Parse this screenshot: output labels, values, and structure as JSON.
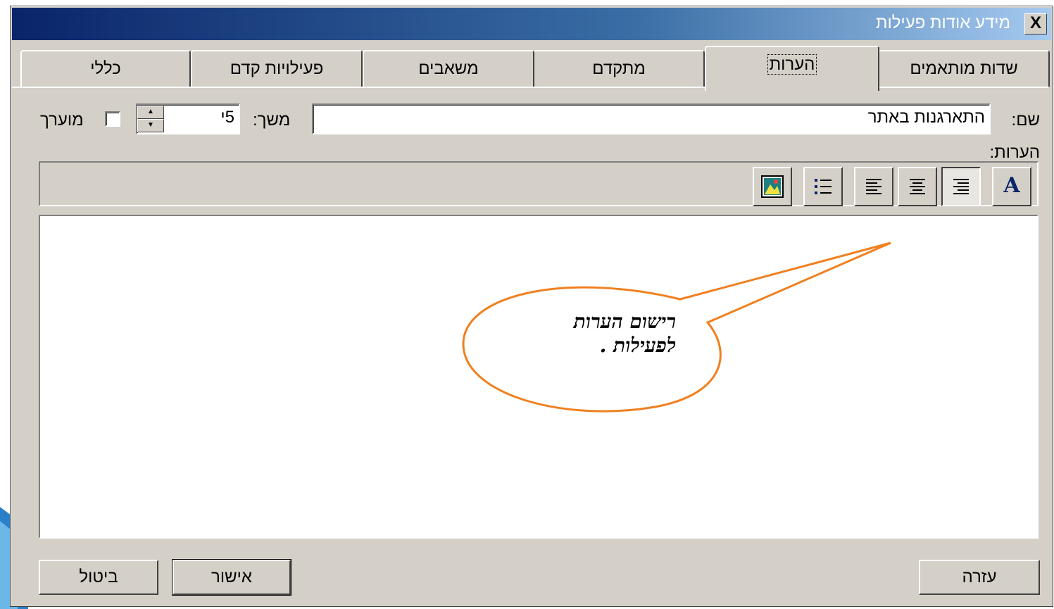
{
  "window": {
    "title": "מידע אודות פעילות",
    "close_label": "X"
  },
  "tabs": [
    {
      "label": "שדות מותאמים",
      "active": false
    },
    {
      "label": "הערות",
      "active": true
    },
    {
      "label": "מתקדם",
      "active": false
    },
    {
      "label": "משאבים",
      "active": false
    },
    {
      "label": "פעילויות קדם",
      "active": false
    },
    {
      "label": "כללי",
      "active": false
    }
  ],
  "form": {
    "name_label": "שם:",
    "name_value": "התארגנות באתר",
    "duration_label": "משך:",
    "duration_value": "5י",
    "estimated_label": "מוערך",
    "estimated_checked": false,
    "notes_label": "הערות:"
  },
  "toolbar": {
    "font_label": "A",
    "buttons": [
      "font-icon",
      "align-right-icon",
      "align-center-icon",
      "align-left-icon",
      "bullet-list-icon",
      "insert-object-icon"
    ]
  },
  "callout": {
    "line1": "רישום הערות",
    "line2": "לפעילות ."
  },
  "buttons": {
    "help": "עזרה",
    "ok": "אישור",
    "cancel": "ביטול"
  },
  "colors": {
    "title_gradient_start": "#0a246a",
    "title_gradient_end": "#a6caf0",
    "callout_stroke": "#f08020",
    "dialog_bg": "#d4d0c8"
  }
}
